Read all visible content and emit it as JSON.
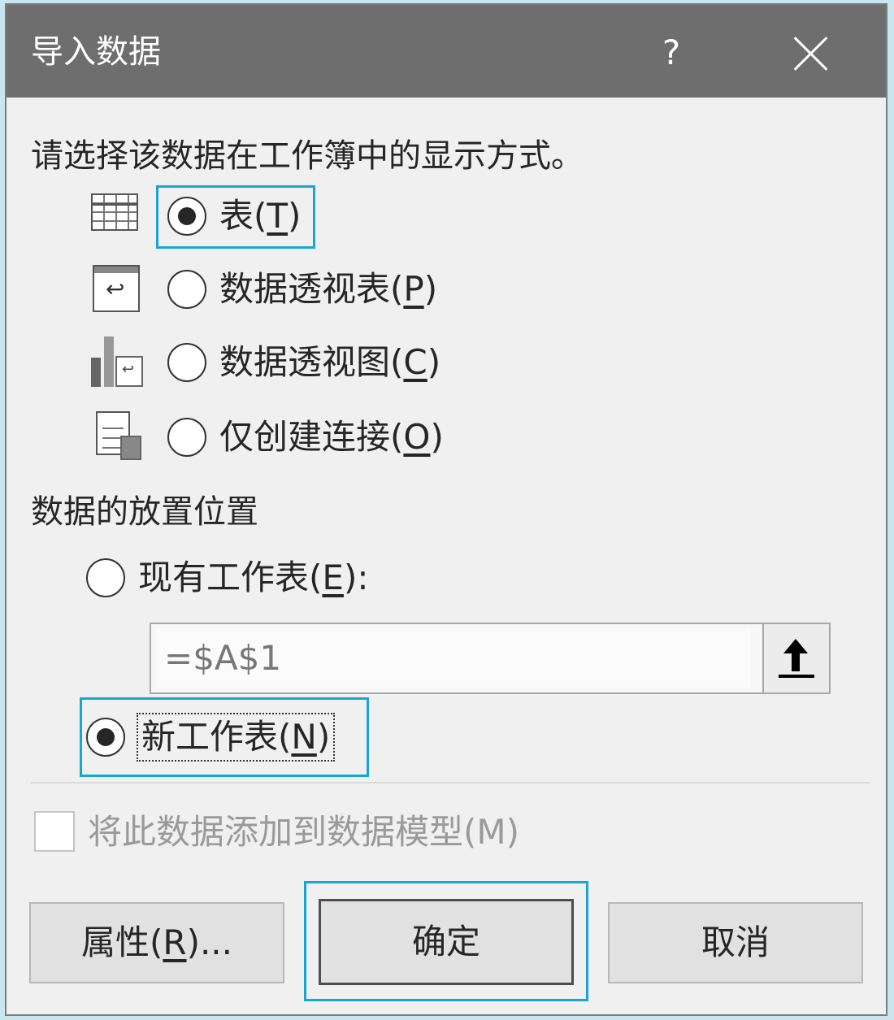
{
  "dialog": {
    "title": "导入数据",
    "help": "?"
  },
  "view": {
    "prompt": "请选择该数据在工作簿中的显示方式。",
    "options": [
      {
        "label": "表(",
        "key": "T",
        "suffix": ")",
        "icon": "table-icon",
        "selected": true
      },
      {
        "label": "数据透视表(",
        "key": "P",
        "suffix": ")",
        "icon": "pivot-table-icon",
        "selected": false
      },
      {
        "label": "数据透视图(",
        "key": "C",
        "suffix": ")",
        "icon": "pivot-chart-icon",
        "selected": false
      },
      {
        "label": "仅创建连接(",
        "key": "O",
        "suffix": ")",
        "icon": "connection-only-icon",
        "selected": false
      }
    ]
  },
  "placement": {
    "heading": "数据的放置位置",
    "existing": {
      "label": "现有工作表(",
      "key": "E",
      "suffix": "):",
      "selected": false
    },
    "range_value": "=$A$1",
    "new_sheet": {
      "label": "新工作表(",
      "key": "N",
      "suffix": ")",
      "selected": true
    }
  },
  "data_model": {
    "label": "将此数据添加到数据模型(M)",
    "checked": false,
    "enabled": false
  },
  "buttons": {
    "properties": "属性(",
    "properties_key": "R",
    "properties_suffix": ")...",
    "ok": "确定",
    "cancel": "取消"
  },
  "colors": {
    "titlebar": "#6e6e6e",
    "focus": "#16a6d9",
    "dialog_bg": "#f0f0f0"
  }
}
